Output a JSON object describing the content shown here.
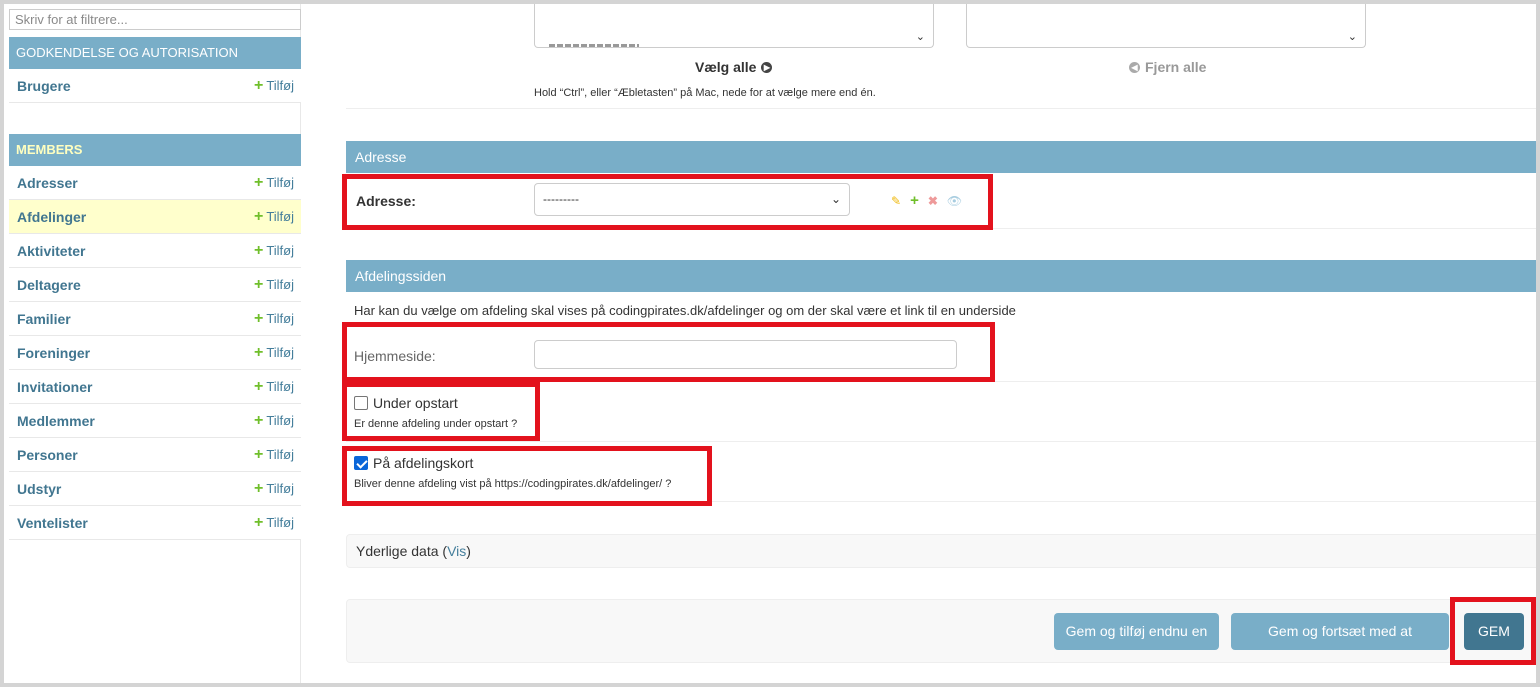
{
  "sidebar": {
    "filter_placeholder": "Skriv for at filtrere...",
    "modules": [
      {
        "caption": "GODKENDELSE OG AUTORISATION",
        "models": [
          {
            "name": "Brugere",
            "add": "Tilføj"
          }
        ]
      },
      {
        "caption": "MEMBERS",
        "models": [
          {
            "name": "Adresser",
            "add": "Tilføj"
          },
          {
            "name": "Afdelinger",
            "add": "Tilføj"
          },
          {
            "name": "Aktiviteter",
            "add": "Tilføj"
          },
          {
            "name": "Deltagere",
            "add": "Tilføj"
          },
          {
            "name": "Familier",
            "add": "Tilføj"
          },
          {
            "name": "Foreninger",
            "add": "Tilføj"
          },
          {
            "name": "Invitationer",
            "add": "Tilføj"
          },
          {
            "name": "Medlemmer",
            "add": "Tilføj"
          },
          {
            "name": "Personer",
            "add": "Tilføj"
          },
          {
            "name": "Udstyr",
            "add": "Tilføj"
          },
          {
            "name": "Ventelister",
            "add": "Tilføj"
          }
        ]
      }
    ]
  },
  "selector": {
    "choose_all": "Vælg alle",
    "remove_all": "Fjern alle",
    "help": "Hold “Ctrl”, eller “Æbletasten” på Mac, nede for at vælge mere end én."
  },
  "adresse": {
    "caption": "Adresse",
    "label": "Adresse:",
    "selected": "---------"
  },
  "afdelingssiden": {
    "caption": "Afdelingssiden",
    "description": "Har kan du vælge om afdeling skal vises på codingpirates.dk/afdelinger og om der skal være et link til en underside",
    "homepage_label": "Hjemmeside:",
    "homepage_value": "",
    "under_opstart": {
      "label": "Under opstart",
      "help": "Er denne afdeling under opstart ?",
      "checked": false
    },
    "paa_kort": {
      "label": "På afdelingskort",
      "help": "Bliver denne afdeling vist på https://codingpirates.dk/afdelinger/ ?",
      "checked": true
    }
  },
  "extra": {
    "text": "Yderlige data (",
    "link": "Vis",
    "end": ")"
  },
  "buttons": {
    "save_add": "Gem og tilføj endnu en",
    "save_continue": "Gem og fortsæt med at redigere",
    "save": "GEM"
  },
  "colors": {
    "caption_bg": "#79aec8",
    "highlight_red": "#e3121d",
    "button_default": "#417690"
  }
}
